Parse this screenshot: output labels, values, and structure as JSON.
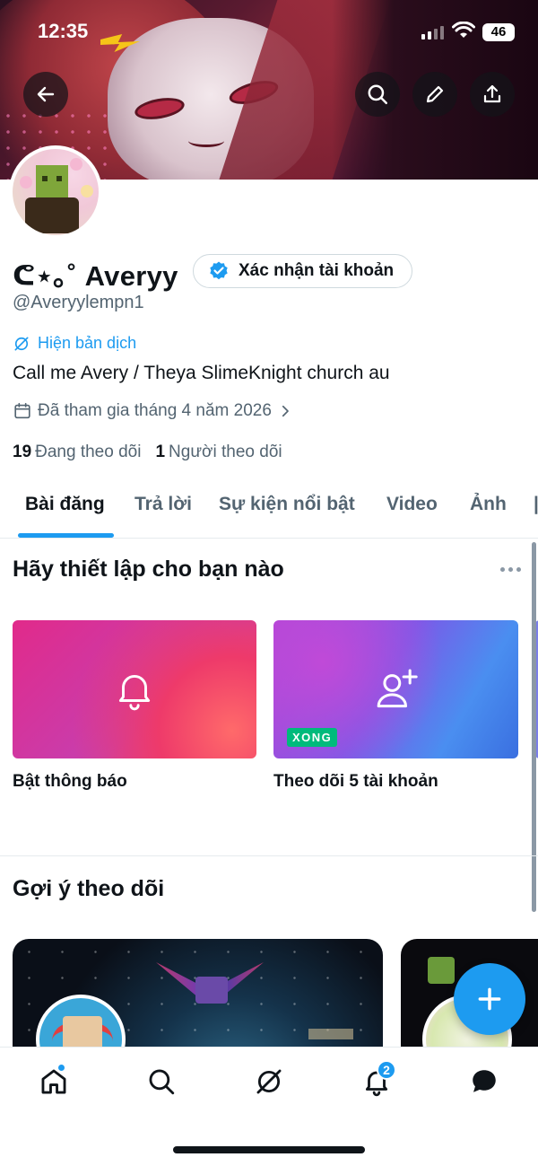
{
  "status_bar": {
    "time": "12:35",
    "battery": "46"
  },
  "profile": {
    "display_name": "ᕦ⋆｡˚ Averyy",
    "verify_button_label": "Xác nhận tài khoản",
    "handle": "@Averyylempn1",
    "translate_label": "Hiện bản dịch",
    "bio": "Call me Avery / Theya SlimeKnight church au",
    "joined": "Đã tham gia tháng 4 năm 2026",
    "following_count": "19",
    "following_label": "Đang theo dõi",
    "followers_count": "1",
    "followers_label": "Người theo dõi"
  },
  "tabs": [
    {
      "label": "Bài đăng",
      "active": true
    },
    {
      "label": "Trả lời"
    },
    {
      "label": "Sự kiện nổi bật"
    },
    {
      "label": "Video"
    },
    {
      "label": "Ảnh"
    }
  ],
  "setup": {
    "title": "Hãy thiết lập cho bạn nào",
    "cards": [
      {
        "label": "Bật thông báo",
        "icon": "bell-icon"
      },
      {
        "label": "Theo dõi 5 tài khoản",
        "icon": "add-user-icon",
        "badge": "XONG"
      }
    ]
  },
  "suggestions": {
    "title": "Gợi ý theo dõi"
  },
  "bottom_nav": {
    "items": [
      "home-icon",
      "search-icon",
      "grok-icon",
      "notifications-icon",
      "messages-icon"
    ],
    "notifications_badge": "2"
  },
  "colors": {
    "accent": "#1d9bf0",
    "done_badge": "#00ba7c",
    "text": "#0f1419",
    "secondary": "#536471"
  }
}
